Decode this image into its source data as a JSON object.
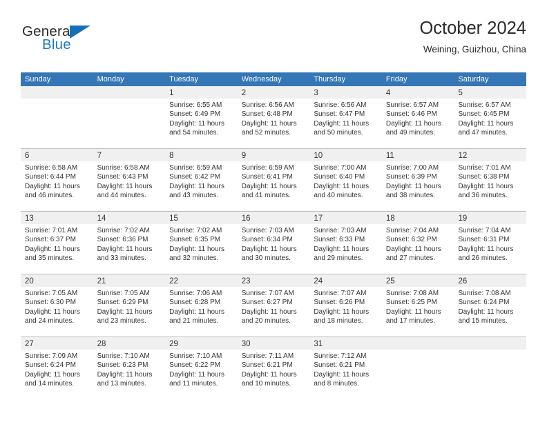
{
  "brand": {
    "name_top": "General",
    "name_bottom": "Blue"
  },
  "header": {
    "title": "October 2024",
    "location": "Weining, Guizhou, China"
  },
  "colors": {
    "header_blue": "#3476b6",
    "logo_blue": "#1e7ac0",
    "date_band": "#f0f0f0",
    "grid_line": "#bfbfbf"
  },
  "calendar": {
    "weekday_headers": [
      "Sunday",
      "Monday",
      "Tuesday",
      "Wednesday",
      "Thursday",
      "Friday",
      "Saturday"
    ],
    "weeks": [
      [
        {
          "day": "",
          "sunrise": "",
          "sunset": "",
          "daylight1": "",
          "daylight2": ""
        },
        {
          "day": "",
          "sunrise": "",
          "sunset": "",
          "daylight1": "",
          "daylight2": ""
        },
        {
          "day": "1",
          "sunrise": "Sunrise: 6:55 AM",
          "sunset": "Sunset: 6:49 PM",
          "daylight1": "Daylight: 11 hours",
          "daylight2": "and 54 minutes."
        },
        {
          "day": "2",
          "sunrise": "Sunrise: 6:56 AM",
          "sunset": "Sunset: 6:48 PM",
          "daylight1": "Daylight: 11 hours",
          "daylight2": "and 52 minutes."
        },
        {
          "day": "3",
          "sunrise": "Sunrise: 6:56 AM",
          "sunset": "Sunset: 6:47 PM",
          "daylight1": "Daylight: 11 hours",
          "daylight2": "and 50 minutes."
        },
        {
          "day": "4",
          "sunrise": "Sunrise: 6:57 AM",
          "sunset": "Sunset: 6:46 PM",
          "daylight1": "Daylight: 11 hours",
          "daylight2": "and 49 minutes."
        },
        {
          "day": "5",
          "sunrise": "Sunrise: 6:57 AM",
          "sunset": "Sunset: 6:45 PM",
          "daylight1": "Daylight: 11 hours",
          "daylight2": "and 47 minutes."
        }
      ],
      [
        {
          "day": "6",
          "sunrise": "Sunrise: 6:58 AM",
          "sunset": "Sunset: 6:44 PM",
          "daylight1": "Daylight: 11 hours",
          "daylight2": "and 46 minutes."
        },
        {
          "day": "7",
          "sunrise": "Sunrise: 6:58 AM",
          "sunset": "Sunset: 6:43 PM",
          "daylight1": "Daylight: 11 hours",
          "daylight2": "and 44 minutes."
        },
        {
          "day": "8",
          "sunrise": "Sunrise: 6:59 AM",
          "sunset": "Sunset: 6:42 PM",
          "daylight1": "Daylight: 11 hours",
          "daylight2": "and 43 minutes."
        },
        {
          "day": "9",
          "sunrise": "Sunrise: 6:59 AM",
          "sunset": "Sunset: 6:41 PM",
          "daylight1": "Daylight: 11 hours",
          "daylight2": "and 41 minutes."
        },
        {
          "day": "10",
          "sunrise": "Sunrise: 7:00 AM",
          "sunset": "Sunset: 6:40 PM",
          "daylight1": "Daylight: 11 hours",
          "daylight2": "and 40 minutes."
        },
        {
          "day": "11",
          "sunrise": "Sunrise: 7:00 AM",
          "sunset": "Sunset: 6:39 PM",
          "daylight1": "Daylight: 11 hours",
          "daylight2": "and 38 minutes."
        },
        {
          "day": "12",
          "sunrise": "Sunrise: 7:01 AM",
          "sunset": "Sunset: 6:38 PM",
          "daylight1": "Daylight: 11 hours",
          "daylight2": "and 36 minutes."
        }
      ],
      [
        {
          "day": "13",
          "sunrise": "Sunrise: 7:01 AM",
          "sunset": "Sunset: 6:37 PM",
          "daylight1": "Daylight: 11 hours",
          "daylight2": "and 35 minutes."
        },
        {
          "day": "14",
          "sunrise": "Sunrise: 7:02 AM",
          "sunset": "Sunset: 6:36 PM",
          "daylight1": "Daylight: 11 hours",
          "daylight2": "and 33 minutes."
        },
        {
          "day": "15",
          "sunrise": "Sunrise: 7:02 AM",
          "sunset": "Sunset: 6:35 PM",
          "daylight1": "Daylight: 11 hours",
          "daylight2": "and 32 minutes."
        },
        {
          "day": "16",
          "sunrise": "Sunrise: 7:03 AM",
          "sunset": "Sunset: 6:34 PM",
          "daylight1": "Daylight: 11 hours",
          "daylight2": "and 30 minutes."
        },
        {
          "day": "17",
          "sunrise": "Sunrise: 7:03 AM",
          "sunset": "Sunset: 6:33 PM",
          "daylight1": "Daylight: 11 hours",
          "daylight2": "and 29 minutes."
        },
        {
          "day": "18",
          "sunrise": "Sunrise: 7:04 AM",
          "sunset": "Sunset: 6:32 PM",
          "daylight1": "Daylight: 11 hours",
          "daylight2": "and 27 minutes."
        },
        {
          "day": "19",
          "sunrise": "Sunrise: 7:04 AM",
          "sunset": "Sunset: 6:31 PM",
          "daylight1": "Daylight: 11 hours",
          "daylight2": "and 26 minutes."
        }
      ],
      [
        {
          "day": "20",
          "sunrise": "Sunrise: 7:05 AM",
          "sunset": "Sunset: 6:30 PM",
          "daylight1": "Daylight: 11 hours",
          "daylight2": "and 24 minutes."
        },
        {
          "day": "21",
          "sunrise": "Sunrise: 7:05 AM",
          "sunset": "Sunset: 6:29 PM",
          "daylight1": "Daylight: 11 hours",
          "daylight2": "and 23 minutes."
        },
        {
          "day": "22",
          "sunrise": "Sunrise: 7:06 AM",
          "sunset": "Sunset: 6:28 PM",
          "daylight1": "Daylight: 11 hours",
          "daylight2": "and 21 minutes."
        },
        {
          "day": "23",
          "sunrise": "Sunrise: 7:07 AM",
          "sunset": "Sunset: 6:27 PM",
          "daylight1": "Daylight: 11 hours",
          "daylight2": "and 20 minutes."
        },
        {
          "day": "24",
          "sunrise": "Sunrise: 7:07 AM",
          "sunset": "Sunset: 6:26 PM",
          "daylight1": "Daylight: 11 hours",
          "daylight2": "and 18 minutes."
        },
        {
          "day": "25",
          "sunrise": "Sunrise: 7:08 AM",
          "sunset": "Sunset: 6:25 PM",
          "daylight1": "Daylight: 11 hours",
          "daylight2": "and 17 minutes."
        },
        {
          "day": "26",
          "sunrise": "Sunrise: 7:08 AM",
          "sunset": "Sunset: 6:24 PM",
          "daylight1": "Daylight: 11 hours",
          "daylight2": "and 15 minutes."
        }
      ],
      [
        {
          "day": "27",
          "sunrise": "Sunrise: 7:09 AM",
          "sunset": "Sunset: 6:24 PM",
          "daylight1": "Daylight: 11 hours",
          "daylight2": "and 14 minutes."
        },
        {
          "day": "28",
          "sunrise": "Sunrise: 7:10 AM",
          "sunset": "Sunset: 6:23 PM",
          "daylight1": "Daylight: 11 hours",
          "daylight2": "and 13 minutes."
        },
        {
          "day": "29",
          "sunrise": "Sunrise: 7:10 AM",
          "sunset": "Sunset: 6:22 PM",
          "daylight1": "Daylight: 11 hours",
          "daylight2": "and 11 minutes."
        },
        {
          "day": "30",
          "sunrise": "Sunrise: 7:11 AM",
          "sunset": "Sunset: 6:21 PM",
          "daylight1": "Daylight: 11 hours",
          "daylight2": "and 10 minutes."
        },
        {
          "day": "31",
          "sunrise": "Sunrise: 7:12 AM",
          "sunset": "Sunset: 6:21 PM",
          "daylight1": "Daylight: 11 hours",
          "daylight2": "and 8 minutes."
        },
        {
          "day": "",
          "sunrise": "",
          "sunset": "",
          "daylight1": "",
          "daylight2": ""
        },
        {
          "day": "",
          "sunrise": "",
          "sunset": "",
          "daylight1": "",
          "daylight2": ""
        }
      ]
    ]
  }
}
